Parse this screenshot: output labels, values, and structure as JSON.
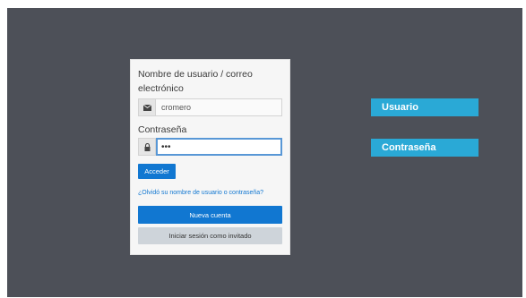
{
  "login": {
    "username_label": "Nombre de usuario / correo electrónico",
    "username_value": "cromero",
    "password_label": "Contraseña",
    "password_value": "•••",
    "submit_label": "Acceder",
    "forgot_link": "¿Olvidó su nombre de usuario o contraseña?",
    "new_account_label": "Nueva cuenta",
    "guest_label": "Iniciar sesión como invitado"
  },
  "tags": {
    "username": "Usuario",
    "password": "Contraseña"
  },
  "icons": {
    "username": "envelope-icon",
    "password": "lock-icon"
  },
  "colors": {
    "background": "#4d5058",
    "primary": "#1177d1",
    "tag": "#2aa9d6"
  }
}
